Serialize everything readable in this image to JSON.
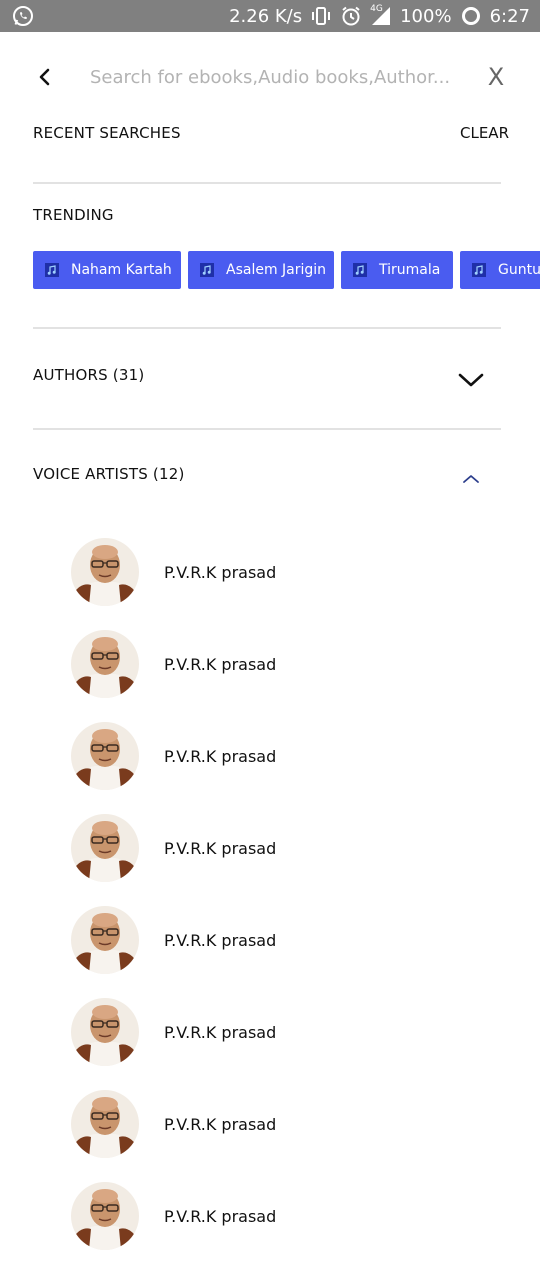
{
  "status_bar": {
    "speed": "2.26 K/s",
    "network": "4G",
    "battery": "100%",
    "time": "6:27"
  },
  "search": {
    "placeholder": "Search for ebooks,Audio books,Author...",
    "value": "",
    "close_label": "X"
  },
  "recent": {
    "label": "RECENT SEARCHES",
    "clear_label": "CLEAR"
  },
  "trending": {
    "label": "TRENDING",
    "chips": [
      {
        "label": "Naham Kartah"
      },
      {
        "label": "Asalem Jarigin"
      },
      {
        "label": "Tirumala"
      },
      {
        "label": "Guntur"
      }
    ],
    "chip_color": "#4a5cf0"
  },
  "authors": {
    "label": "AUTHORS (31)",
    "expanded": false
  },
  "voice_artists": {
    "label": "VOICE ARTISTS (12)",
    "expanded": true,
    "items": [
      {
        "name": "P.V.R.K prasad"
      },
      {
        "name": "P.V.R.K prasad"
      },
      {
        "name": "P.V.R.K prasad"
      },
      {
        "name": "P.V.R.K prasad"
      },
      {
        "name": "P.V.R.K prasad"
      },
      {
        "name": "P.V.R.K prasad"
      },
      {
        "name": "P.V.R.K prasad"
      },
      {
        "name": "P.V.R.K prasad"
      }
    ]
  }
}
